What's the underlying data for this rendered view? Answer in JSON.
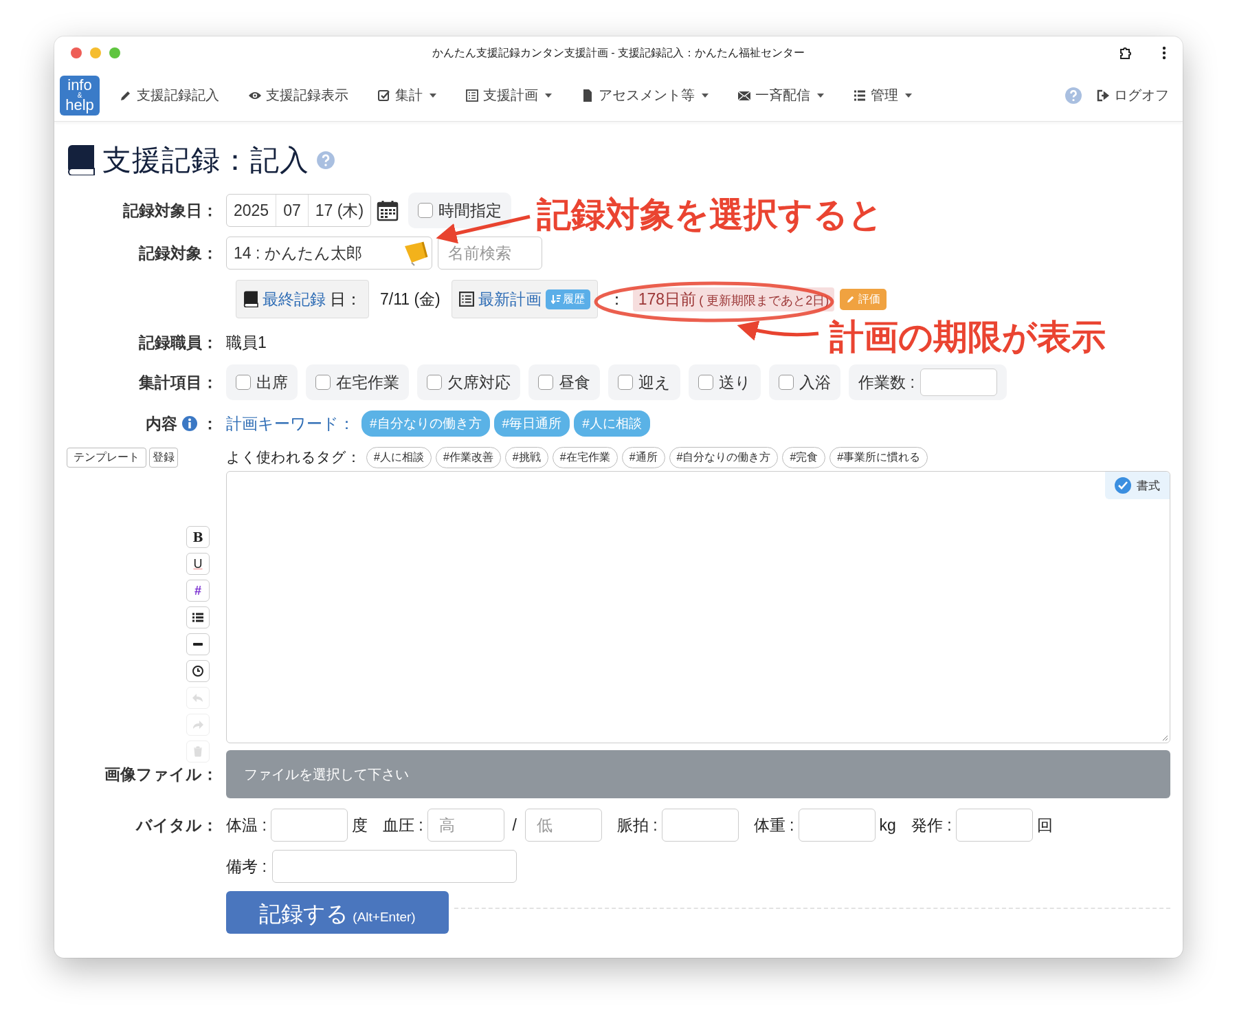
{
  "window": {
    "title": "かんたん支援記録カンタン支援計画 - 支援記録記入：かんたん福祉センター"
  },
  "nav": {
    "logo": [
      "info",
      "&",
      "help"
    ],
    "items": [
      {
        "label": "支援記録記入",
        "dropdown": false
      },
      {
        "label": "支援記録表示",
        "dropdown": false
      },
      {
        "label": "集計",
        "dropdown": true
      },
      {
        "label": "支援計画",
        "dropdown": true
      },
      {
        "label": "アセスメント等",
        "dropdown": true
      },
      {
        "label": "一斉配信",
        "dropdown": true
      },
      {
        "label": "管理",
        "dropdown": true
      }
    ],
    "logoff": "ログオフ"
  },
  "heading": "支援記録：記入",
  "date": {
    "label": "記録対象日：",
    "year": "2025",
    "month": "07",
    "day": "17 (木)",
    "time_toggle": {
      "label": "時間指定",
      "checked": false
    }
  },
  "subject": {
    "label": "記録対象：",
    "value": "14 : かんたん太郎",
    "search_placeholder": "名前検索"
  },
  "summary": {
    "last_record_link": "最終記録",
    "last_record_suffix": "日：",
    "last_record_date": "7/11 (金)",
    "plan_link": "最新計画",
    "history_badge": "履歴",
    "separator": "：",
    "days": "178日前",
    "deadline_note": "( 更新期限まであと2日)",
    "eval_badge": "評価"
  },
  "staff": {
    "label": "記録職員：",
    "value": "職員1"
  },
  "tally": {
    "label": "集計項目：",
    "items": [
      {
        "label": "出席",
        "checked": false
      },
      {
        "label": "在宅作業",
        "checked": false
      },
      {
        "label": "欠席対応",
        "checked": false
      },
      {
        "label": "昼食",
        "checked": false
      },
      {
        "label": "迎え",
        "checked": false
      },
      {
        "label": "送り",
        "checked": false
      },
      {
        "label": "入浴",
        "checked": false
      }
    ],
    "work_count_label": "作業数 :"
  },
  "content": {
    "label": "内容",
    "colon": "：",
    "keywords_label": "計画キーワード：",
    "keywords": [
      "#自分なりの働き方",
      "#毎日通所",
      "#人に相談"
    ],
    "template_button": "テンプレート",
    "register_button": "登録",
    "tags_label": "よく使われるタグ：",
    "tags": [
      "#人に相談",
      "#作業改善",
      "#挑戦",
      "#在宅作業",
      "#通所",
      "#自分なりの働き方",
      "#完食",
      "#事業所に慣れる"
    ]
  },
  "editor": {
    "format_toggle": {
      "label": "書式",
      "checked": true
    },
    "toolbar": [
      {
        "label": "B",
        "disabled": false
      },
      {
        "label": "U",
        "disabled": false
      },
      {
        "label": "#",
        "disabled": false
      },
      {
        "disabled": false
      },
      {
        "disabled": false
      },
      {
        "disabled": false
      },
      {
        "disabled": true
      },
      {
        "disabled": true
      },
      {
        "disabled": true
      }
    ]
  },
  "image_file": {
    "label": "画像ファイル：",
    "placeholder": "ファイルを選択して下さい"
  },
  "vitals": {
    "label": "バイタル：",
    "fields": [
      {
        "label": "体温 :",
        "unit": "度"
      },
      {
        "label": "血圧 :",
        "placeholders": [
          "高",
          "低"
        ],
        "separator": "/"
      },
      {
        "label": "脈拍 :"
      },
      {
        "label": "体重 :",
        "unit": "kg"
      },
      {
        "label": "発作 :",
        "unit": "回"
      }
    ]
  },
  "notes": {
    "label": "備考 :"
  },
  "submit": {
    "label": "記録する",
    "shortcut": "(Alt+Enter)"
  },
  "annotations": [
    {
      "text": "記録対象を選択すると"
    },
    {
      "text": "計画の期限が表示"
    }
  ]
}
